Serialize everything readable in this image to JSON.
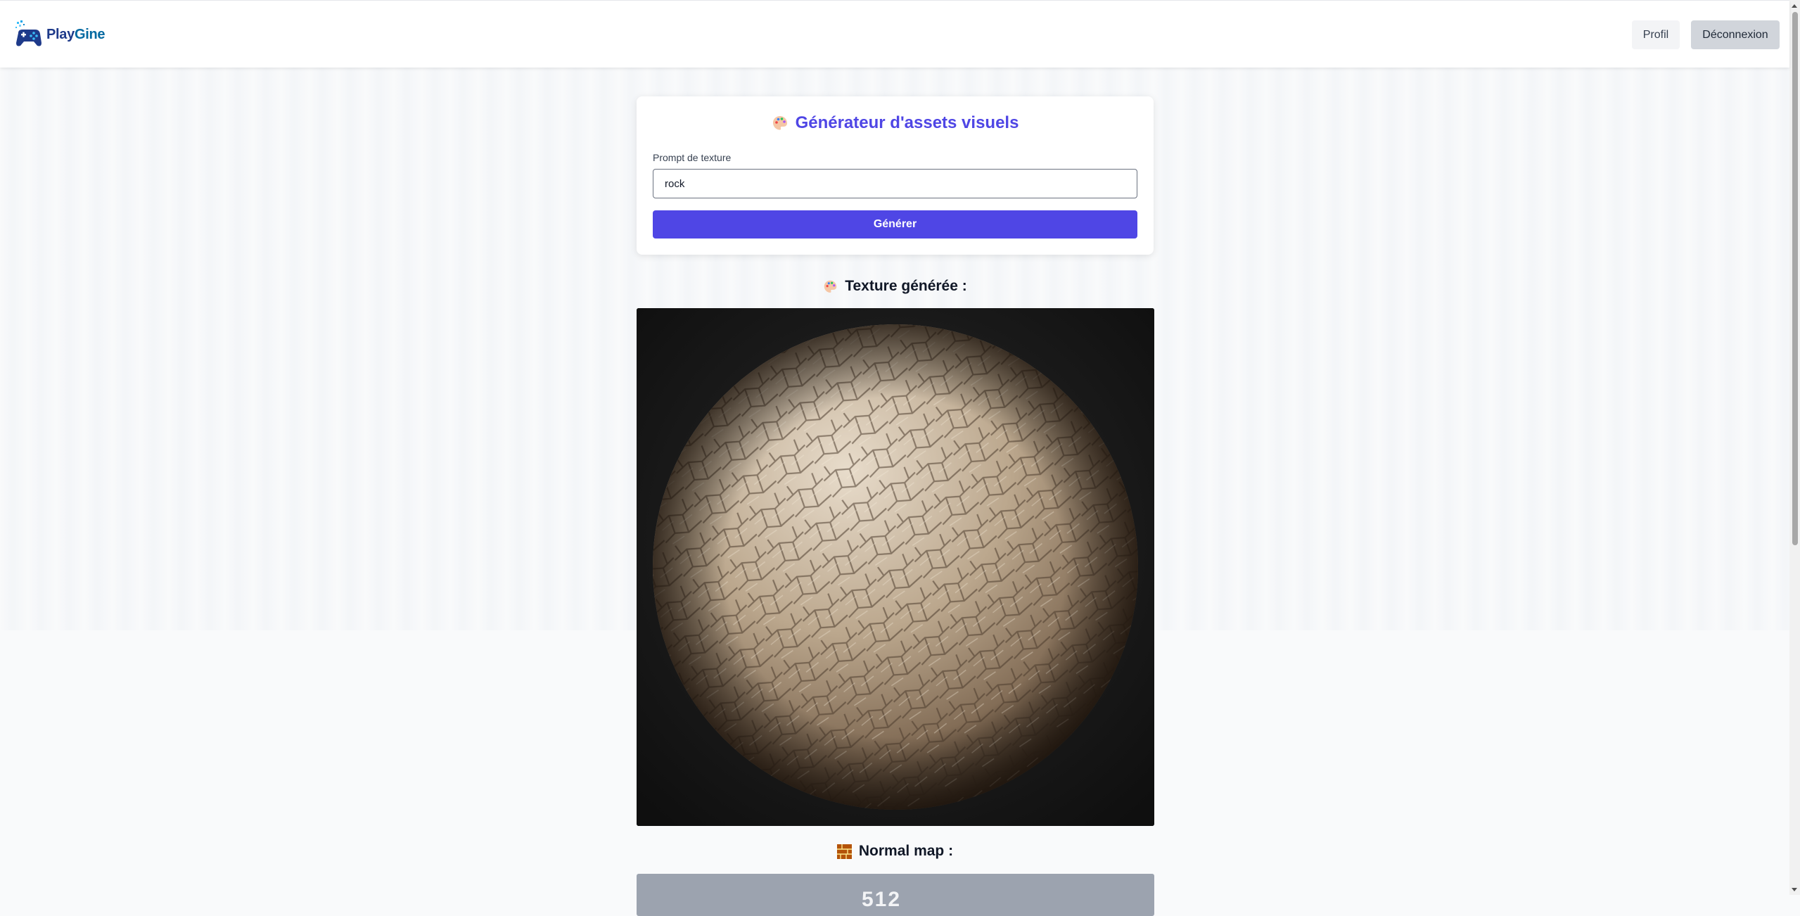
{
  "app": {
    "brand_play": "Play",
    "brand_gine": "Gine"
  },
  "header": {
    "profile_label": "Profil",
    "logout_label": "Déconnexion"
  },
  "generator": {
    "title": "Générateur d'assets visuels",
    "prompt_label": "Prompt de texture",
    "prompt_value": "rock",
    "generate_label": "Générer"
  },
  "results": {
    "texture_heading": "Texture générée :",
    "normal_heading": "Normal map :",
    "normal_preview_text": "512"
  },
  "icons": {
    "logo": "gamepad-logo-icon",
    "palette": "palette-icon",
    "bricks": "bricks-icon"
  },
  "colors": {
    "accent": "#4f46e5",
    "brand_dark": "#1e3a8a",
    "brand_light": "#0369a1",
    "texture_bg": "#141414"
  }
}
